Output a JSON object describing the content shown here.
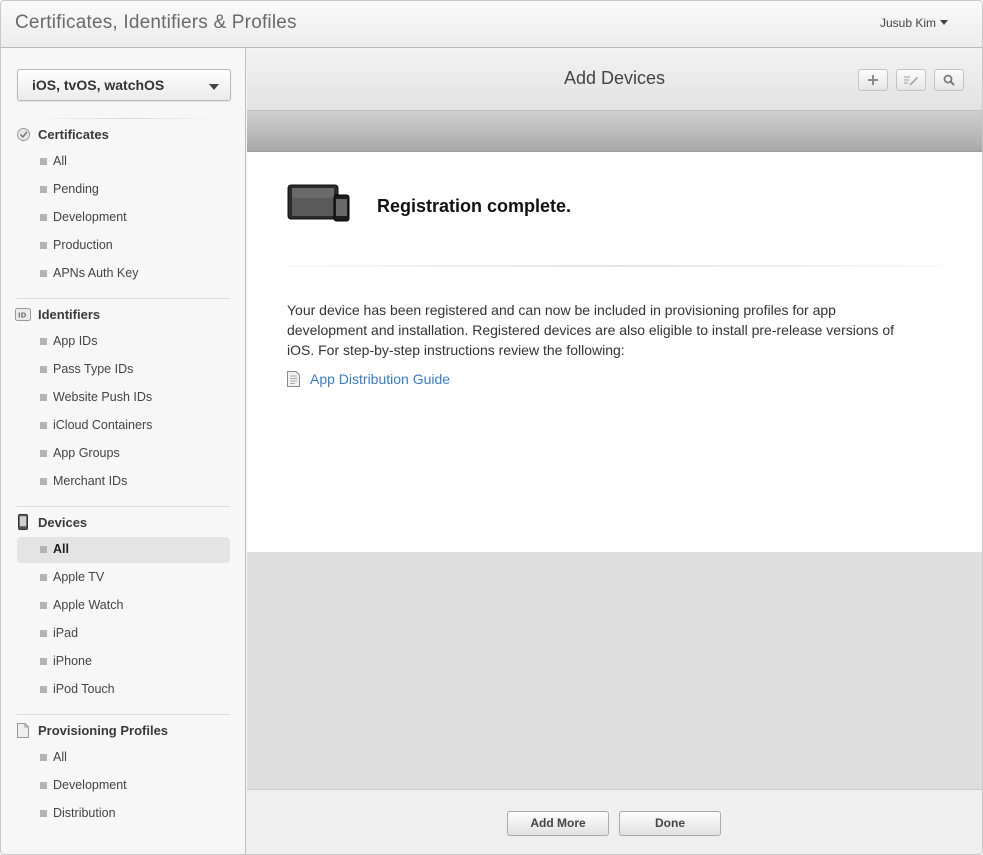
{
  "header": {
    "app_title": "Certificates, Identifiers & Profiles",
    "user_name": "Jusub Kim"
  },
  "sidebar": {
    "platform": "iOS, tvOS, watchOS",
    "sections": [
      {
        "title": "Certificates",
        "icon": "certificate-icon",
        "items": [
          "All",
          "Pending",
          "Development",
          "Production",
          "APNs Auth Key"
        ]
      },
      {
        "title": "Identifiers",
        "icon": "id-badge-icon",
        "items": [
          "App IDs",
          "Pass Type IDs",
          "Website Push IDs",
          "iCloud Containers",
          "App Groups",
          "Merchant IDs"
        ]
      },
      {
        "title": "Devices",
        "icon": "phone-icon",
        "items": [
          "All",
          "Apple TV",
          "Apple Watch",
          "iPad",
          "iPhone",
          "iPod Touch"
        ],
        "active_item": "All"
      },
      {
        "title": "Provisioning Profiles",
        "icon": "document-icon",
        "items": [
          "All",
          "Development",
          "Distribution"
        ]
      }
    ]
  },
  "main": {
    "title": "Add Devices",
    "toolbar": [
      "plus-icon",
      "edit-icon",
      "search-icon"
    ],
    "complete_title": "Registration complete.",
    "message": "Your device has been registered and can now be included in provisioning profiles for app development and installation. Registered devices are also eligible to install pre-release versions of iOS. For step-by-step instructions review the following:",
    "guide_link": "App Distribution Guide"
  },
  "footer": {
    "add_more_label": "Add More",
    "done_label": "Done"
  },
  "colors": {
    "link": "#3a7cc2",
    "active_item_bg": "#e4e4e4"
  }
}
